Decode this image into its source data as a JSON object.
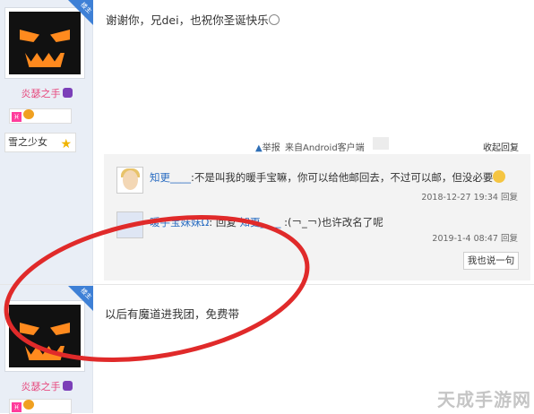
{
  "post1": {
    "badge": "楼主",
    "username": "炎瑟之手",
    "medal_text": "♓",
    "title_tag": "雪之少女",
    "content": "谢谢你，兄dei，也祝你圣诞快乐",
    "report": "举报",
    "source": "来自Android客户端",
    "fold_reply": "收起回复",
    "replies": [
      {
        "user": "知更____",
        "text": ":不是叫我的暖手宝嘛，你可以给他邮回去，不过可以邮，但没必要",
        "time": "2018-12-27 19:34",
        "reply_label": "回复"
      },
      {
        "user": "暖手宝妹妹Ω",
        "reply_prefix": ": 回复 ",
        "target": "知更____",
        "text": " :(￢_￢)也许改名了呢",
        "time": "2019-1-4 08:47",
        "reply_label": "回复"
      }
    ],
    "say_button": "我也说一句"
  },
  "post2": {
    "badge": "楼主",
    "username": "炎瑟之手",
    "content": "以后有魔道进我团，免费带"
  },
  "watermark": "天成手游网"
}
